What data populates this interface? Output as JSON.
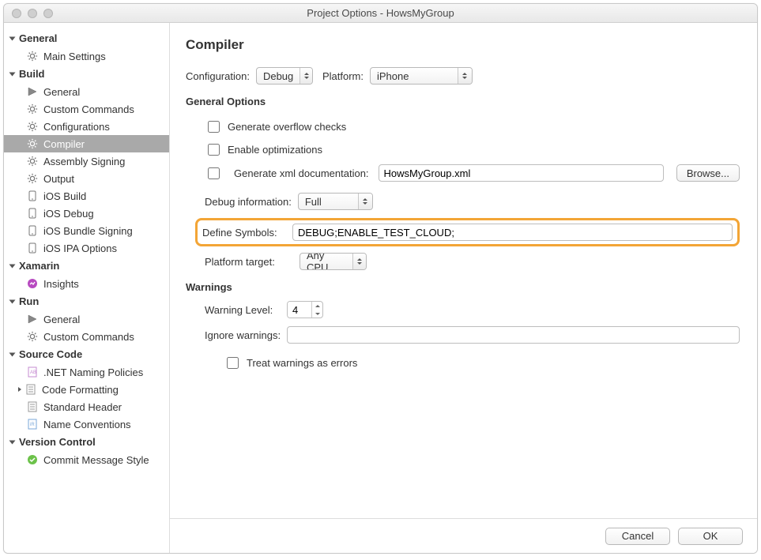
{
  "window_title": "Project Options - HowsMyGroup",
  "sidebar": {
    "general": {
      "header": "General",
      "main_settings": "Main Settings"
    },
    "build": {
      "header": "Build",
      "items": {
        "general": "General",
        "custom_commands": "Custom Commands",
        "configurations": "Configurations",
        "compiler": "Compiler",
        "assembly_signing": "Assembly Signing",
        "output": "Output",
        "ios_build": "iOS Build",
        "ios_debug": "iOS Debug",
        "ios_bundle_signing": "iOS Bundle Signing",
        "ios_ipa_options": "iOS IPA Options"
      }
    },
    "xamarin": {
      "header": "Xamarin",
      "insights": "Insights"
    },
    "run": {
      "header": "Run",
      "general": "General",
      "custom_commands": "Custom Commands"
    },
    "source_code": {
      "header": "Source Code",
      "net_naming": ".NET Naming Policies",
      "code_formatting": "Code Formatting",
      "standard_header": "Standard Header",
      "name_conventions": "Name Conventions"
    },
    "version_control": {
      "header": "Version Control",
      "commit_style": "Commit Message Style"
    }
  },
  "page": {
    "title": "Compiler",
    "configuration_label": "Configuration:",
    "configuration_value": "Debug",
    "platform_label": "Platform:",
    "platform_value": "iPhone",
    "general_options": "General Options",
    "gen_overflow": "Generate overflow checks",
    "enable_opt": "Enable optimizations",
    "gen_xml_doc": "Generate xml documentation:",
    "xml_doc_value": "HowsMyGroup.xml",
    "browse": "Browse...",
    "debug_info_label": "Debug information:",
    "debug_info_value": "Full",
    "define_symbols_label": "Define Symbols:",
    "define_symbols_value": "DEBUG;ENABLE_TEST_CLOUD;",
    "platform_target_label": "Platform target:",
    "platform_target_value": "Any CPU",
    "warnings_header": "Warnings",
    "warning_level_label": "Warning Level:",
    "warning_level_value": "4",
    "ignore_warnings_label": "Ignore warnings:",
    "treat_warnings": "Treat warnings as errors"
  },
  "footer": {
    "cancel": "Cancel",
    "ok": "OK"
  }
}
